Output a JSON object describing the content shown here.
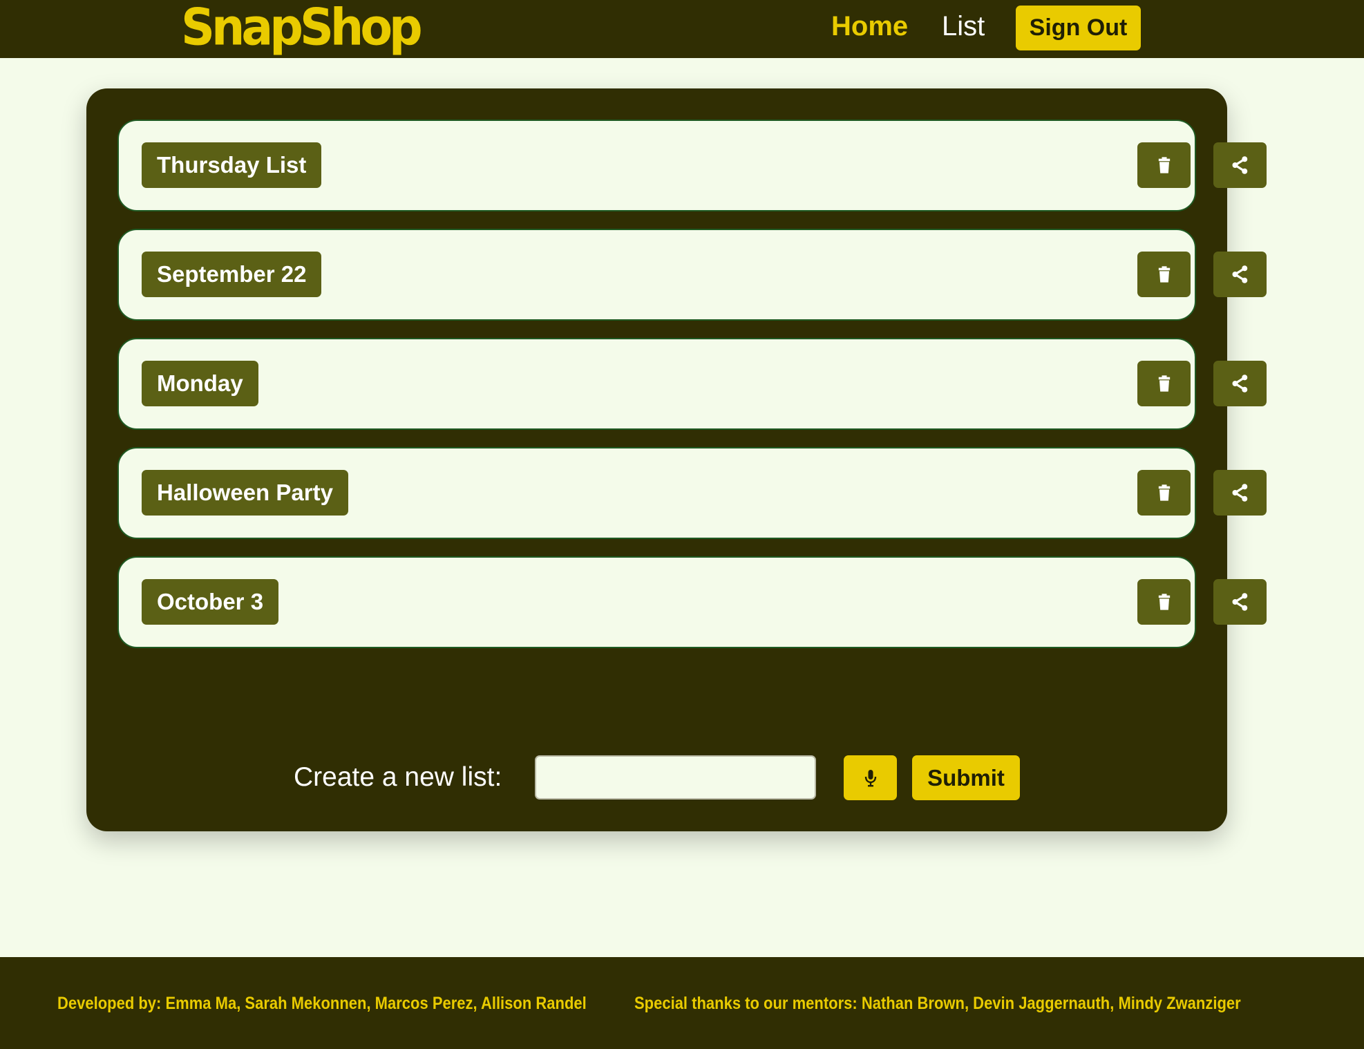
{
  "header": {
    "brand": "SnapShop",
    "nav": {
      "home_label": "Home",
      "list_label": "List"
    },
    "signout_label": "Sign Out"
  },
  "lists": [
    {
      "name": "Thursday List"
    },
    {
      "name": "September 22"
    },
    {
      "name": "Monday"
    },
    {
      "name": "Halloween Party"
    },
    {
      "name": "October 3"
    }
  ],
  "list_actions": {
    "delete_icon": "trash-icon",
    "share_icon": "share-icon"
  },
  "create": {
    "label": "Create a new list:",
    "input_value": "",
    "input_placeholder": "",
    "mic_icon": "microphone-icon",
    "submit_label": "Submit"
  },
  "footer": {
    "developed_by": "Developed by: Emma Ma, Sarah Mekonnen, Marcos Perez, Allison Randel",
    "thanks": "Special thanks to our mentors: Nathan Brown, Devin Jaggernauth, Mindy Zwanziger"
  },
  "colors": {
    "dark_olive": "#302e03",
    "brand_yellow": "#e9cb00",
    "button_olive": "#5b6015",
    "card_background": "#f4fbea",
    "card_border": "#1f5a23"
  }
}
